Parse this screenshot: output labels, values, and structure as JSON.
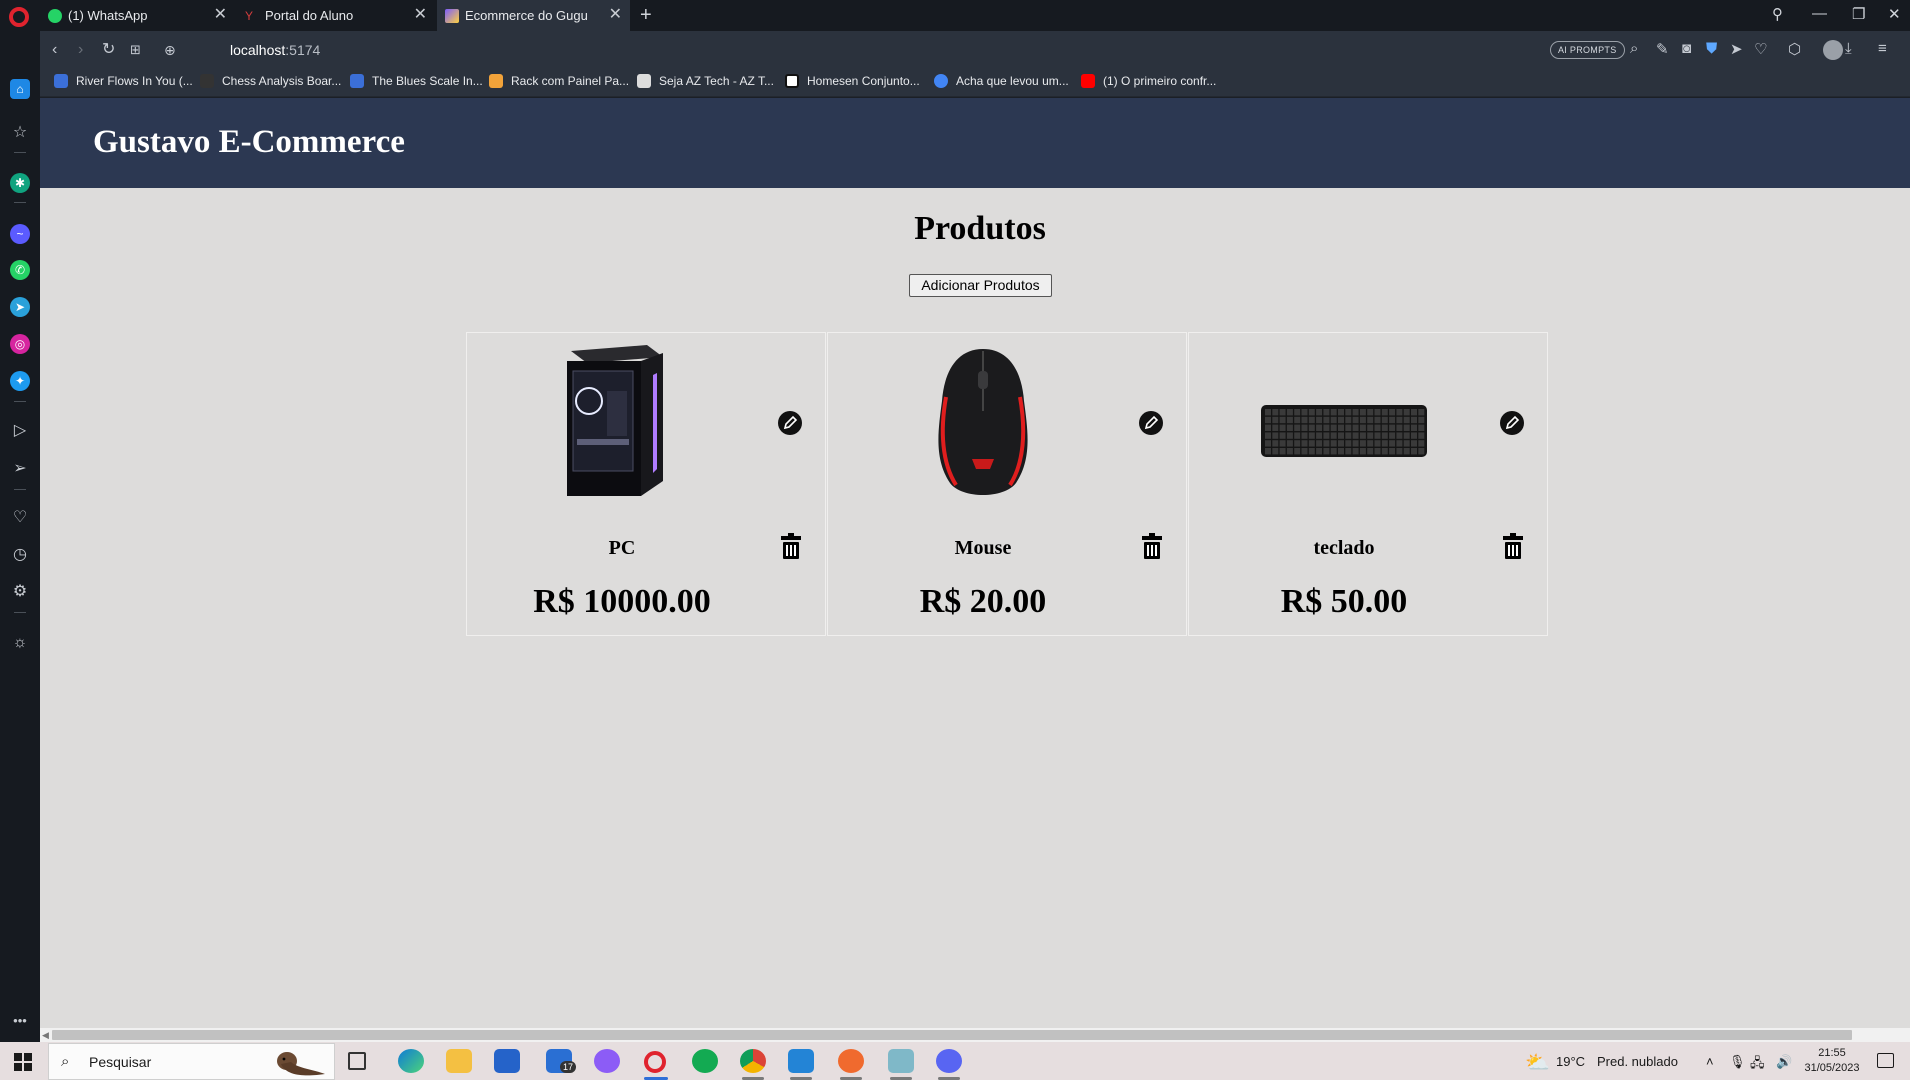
{
  "browser": {
    "tabs": [
      {
        "label": "(1) WhatsApp",
        "active": false
      },
      {
        "label": "Portal do Aluno",
        "active": false
      },
      {
        "label": "Ecommerce do Gugu",
        "active": true
      }
    ],
    "address": {
      "host": "localhost",
      "port": ":5174"
    },
    "ai_prompts_label": "AI PROMPTS",
    "bookmarks": [
      "River Flows In You (...",
      "Chess Analysis Boar...",
      "The Blues Scale In...",
      "Rack com Painel Pa...",
      "Seja AZ Tech - AZ T...",
      "Homesen Conjunto...",
      "Acha que levou um...",
      "(1) O primeiro confr..."
    ]
  },
  "site": {
    "title": "Gustavo E-Commerce",
    "section_title": "Produtos",
    "add_button": "Adicionar Produtos",
    "products": [
      {
        "name": "PC",
        "price": "R$ 10000.00",
        "image": "pc-tower"
      },
      {
        "name": "Mouse",
        "price": "R$ 20.00",
        "image": "gaming-mouse"
      },
      {
        "name": "teclado",
        "price": "R$ 50.00",
        "image": "keyboard"
      }
    ]
  },
  "taskbar": {
    "search_placeholder": "Pesquisar",
    "mail_badge": "17",
    "weather": {
      "temp": "19°C",
      "condition": "Pred. nublado"
    },
    "time": "21:55",
    "date": "31/05/2023"
  },
  "colors": {
    "header_bg": "#2c3852",
    "page_bg": "#dddcdb",
    "browser_chrome": "#2b323d",
    "opera_red": "#e0232e"
  }
}
